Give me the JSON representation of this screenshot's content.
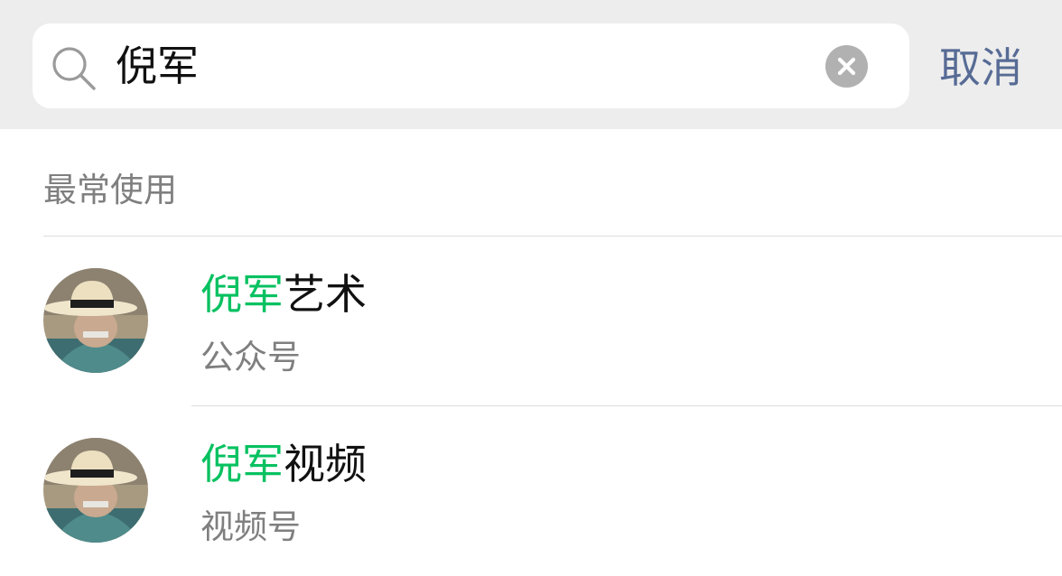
{
  "search": {
    "query": "倪军",
    "cancel_label": "取消"
  },
  "section": {
    "title": "最常使用"
  },
  "results": [
    {
      "title_highlight": "倪军",
      "title_rest": "艺术",
      "subtitle": "公众号"
    },
    {
      "title_highlight": "倪军",
      "title_rest": "视频",
      "subtitle": "视频号"
    }
  ],
  "colors": {
    "highlight": "#07c160",
    "link": "#576b95",
    "secondary_text": "#7f7f7f",
    "bar_background": "#ededed"
  },
  "icons": {
    "search": "search-icon",
    "clear": "clear-icon",
    "avatar": "avatar-icon"
  }
}
